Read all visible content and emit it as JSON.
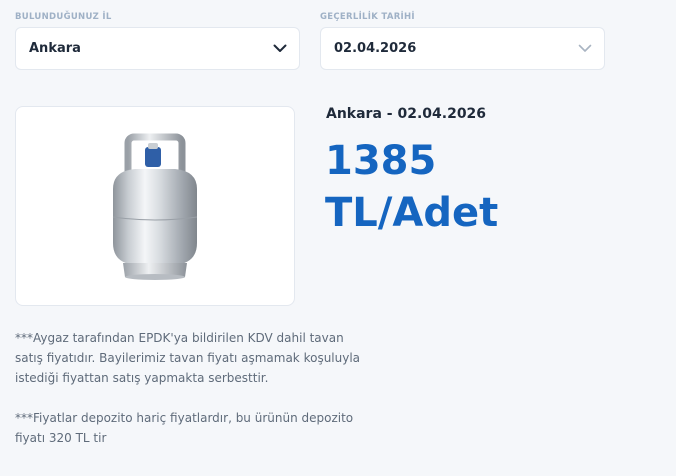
{
  "filters": {
    "city": {
      "label": "BULUNDUĞUNUZ İL",
      "value": "Ankara"
    },
    "date": {
      "label": "GEÇERLİLİK TARİHİ",
      "value": "02.04.2026"
    }
  },
  "product": {
    "image_alt": "propane gas cylinder",
    "heading": "Ankara - 02.04.2026",
    "price": "1385",
    "unit": "TL/Adet",
    "accent_color": "#1565c0"
  },
  "notes": {
    "note1": "***Aygaz tarafından EPDK'ya bildirilen KDV dahil tavan satış fiyatıdır. Bayilerimiz tavan fiyatı aşmamak koşuluyla istediği fiyattan satış yapmakta serbesttir.",
    "note2": "***Fiyatlar depozito hariç fiyatlardır, bu ürünün depozito fiyatı 320 TL tir"
  },
  "icons": {
    "city_dropdown": "chevron-down-icon",
    "date_dropdown": "chevron-down-icon"
  }
}
